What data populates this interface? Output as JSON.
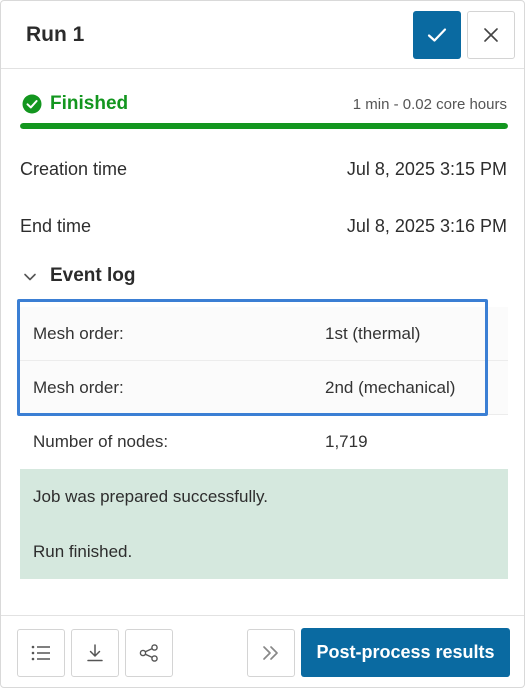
{
  "header": {
    "title": "Run 1"
  },
  "status": {
    "label": "Finished",
    "duration": "1 min - 0.02 core hours",
    "progress_percent": 100,
    "color": "#13961f"
  },
  "info": [
    {
      "label": "Creation time",
      "value": "Jul 8, 2025 3:15 PM"
    },
    {
      "label": "End time",
      "value": "Jul 8, 2025 3:16 PM"
    }
  ],
  "event_log": {
    "title": "Event log",
    "rows": [
      {
        "key": "Mesh order:",
        "value": "1st (thermal)"
      },
      {
        "key": "Mesh order:",
        "value": "2nd (mechanical)"
      },
      {
        "key": "Number of nodes:",
        "value": "1,719"
      }
    ],
    "messages": [
      "Job was prepared successfully.",
      "Run finished."
    ]
  },
  "footer": {
    "primary_label": "Post-process results"
  },
  "colors": {
    "accent": "#0a6aa1",
    "success": "#13961f",
    "highlight": "#3b7fd4",
    "message_bg": "#d5e8de"
  },
  "icons": [
    "check-icon",
    "close-icon",
    "check-circle-icon",
    "chevron-down-icon",
    "list-icon",
    "download-icon",
    "share-icon",
    "double-chevron-right-icon"
  ]
}
